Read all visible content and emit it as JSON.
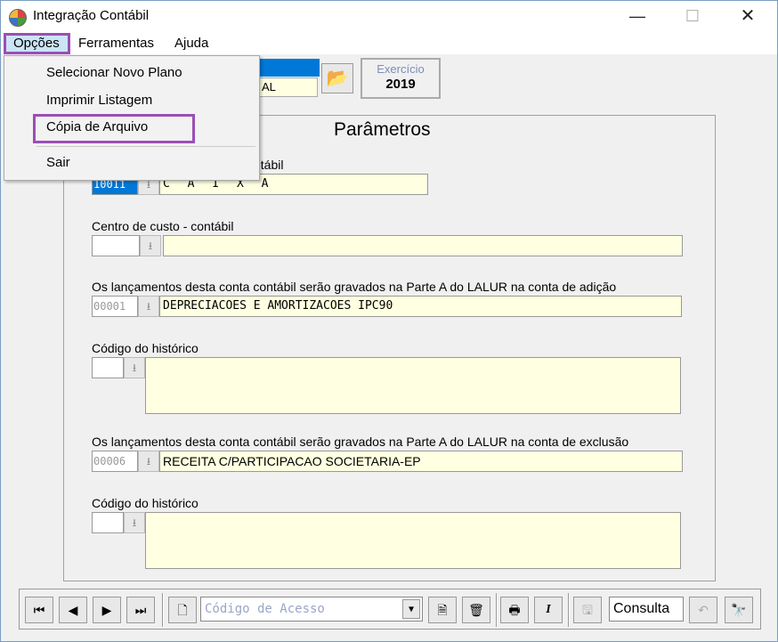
{
  "window": {
    "title": "Integração Contábil",
    "minimize": "—",
    "maximize": "☐",
    "close": "✕"
  },
  "menubar": {
    "items": [
      "Opções",
      "Ferramentas",
      "Ajuda"
    ]
  },
  "dropdown": {
    "items": [
      "Selecionar Novo Plano",
      "Imprimir Listagem",
      "Cópia de Arquivo",
      "Sair"
    ]
  },
  "header": {
    "partial_field_text": "AL",
    "exercicio_label": "Exercício",
    "exercicio_value": "2019"
  },
  "panel": {
    "title": "Parâmetros",
    "field1": {
      "label_partial": "ntábil",
      "code": "10011",
      "description": "C A I X A"
    },
    "field2": {
      "label": "Centro de custo - contábil",
      "code": "",
      "description": ""
    },
    "field3": {
      "label": "Os lançamentos desta conta contábil serão gravados na Parte A do LALUR na conta de adição",
      "code": "00001",
      "description": "DEPRECIACOES E AMORTIZACOES IPC90"
    },
    "field4": {
      "label": "Código do histórico",
      "code": ""
    },
    "field5": {
      "label": "Os lançamentos desta conta contábil serão gravados na Parte A do LALUR na conta de exclusão",
      "code": "00006",
      "description": "RECEITA C/PARTICIPACAO SOCIETARIA-EP"
    },
    "field6": {
      "label": "Código do histórico",
      "code": ""
    }
  },
  "toolbar": {
    "first": "⏮",
    "prev": "◀",
    "next": "▶",
    "last": "⏭",
    "combo_placeholder": "Código de Acesso",
    "combo_arrow": "▼",
    "mode": "Consulta",
    "italic": "I"
  }
}
